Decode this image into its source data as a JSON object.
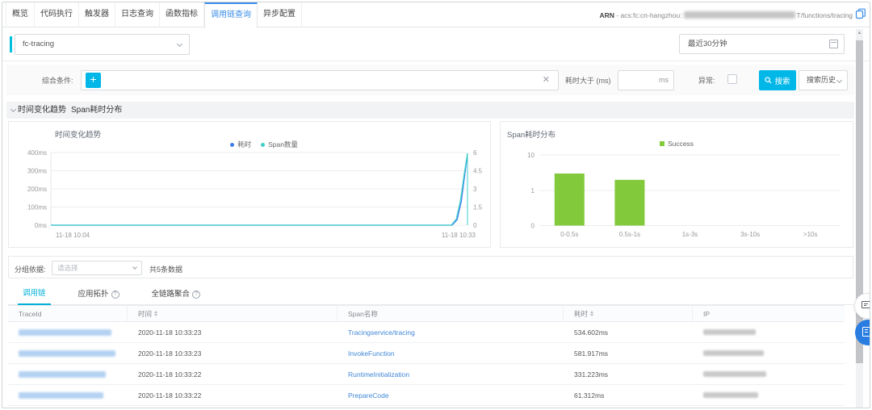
{
  "tabs": {
    "active_index": 5,
    "items": [
      "概览",
      "代码执行",
      "触发器",
      "日志查询",
      "函数指标",
      "调用链查询",
      "异步配置"
    ]
  },
  "arn": {
    "label": "ARN",
    "prefix": " - acs:fc:cn-hangzhou:",
    "redacted": true,
    "suffix": "T/functions/tracing"
  },
  "function_select": {
    "value": "fc-tracing"
  },
  "time_range": {
    "value": "最近30分钟"
  },
  "filter": {
    "condition_label": "综合条件:",
    "duration_label": "耗时大于 (ms)",
    "ms_suffix": "ms",
    "error_label": "异常:",
    "search_label": "搜索",
    "history_label": "搜索历史"
  },
  "section": {
    "title1": "时间变化趋势",
    "title2": "Span耗时分布"
  },
  "chart_data": [
    {
      "type": "line",
      "title": "时间变化趋势",
      "legend": [
        {
          "name": "耗时",
          "color": "#3e7df0"
        },
        {
          "name": "Span数量",
          "color": "#3fcfc9"
        }
      ],
      "series": [
        {
          "name": "耗时",
          "color": "#3e7df0",
          "axis": "left",
          "points": [
            [
              0,
              0
            ],
            [
              0.963,
              0
            ],
            [
              0.975,
              30
            ],
            [
              0.985,
              130
            ],
            [
              0.993,
              270
            ],
            [
              1,
              392
            ]
          ]
        },
        {
          "name": "Span数量",
          "color": "#3fcfc9",
          "axis": "right",
          "points": [
            [
              0,
              0
            ],
            [
              0.961,
              0
            ],
            [
              0.973,
              0.5
            ],
            [
              0.983,
              2.0
            ],
            [
              0.992,
              4.2
            ],
            [
              1,
              5.95
            ]
          ]
        }
      ],
      "left_axis": {
        "labels": [
          "400ms",
          "300ms",
          "200ms",
          "100ms",
          "0ms"
        ],
        "max": 400
      },
      "right_axis": {
        "labels": [
          "6",
          "4.5",
          "3",
          "1.5",
          "0"
        ],
        "max": 6
      },
      "x_labels": [
        "11-18 10:04",
        "11-18 10:33"
      ],
      "grid": true
    },
    {
      "type": "bar",
      "title": "Span耗时分布",
      "legend": [
        {
          "name": "Success",
          "color": "#82c93c"
        }
      ],
      "categories": [
        "0-0.5s",
        "0.5s-1s",
        "1s-3s",
        "3s-10s",
        ">10s"
      ],
      "values": [
        3,
        2,
        0,
        0,
        0
      ],
      "y_ticks": [
        "10",
        "1",
        "0"
      ],
      "scale": "log",
      "color": "#82c93c",
      "grid": true
    }
  ],
  "group_row": {
    "label": "分组依据:",
    "placeholder": "请选择",
    "count": "共5条数据"
  },
  "subtabs": {
    "active_index": 0,
    "items": [
      {
        "label": "调用链",
        "help": false
      },
      {
        "label": "应用拓扑",
        "help": true
      },
      {
        "label": "全链路聚合",
        "help": true
      }
    ]
  },
  "table": {
    "headers": [
      {
        "label": "TraceId",
        "sortable": false
      },
      {
        "label": "时间",
        "sortable": true
      },
      {
        "label": "Span名称",
        "sortable": false
      },
      {
        "label": "耗时",
        "sortable": true
      },
      {
        "label": "IP",
        "sortable": false
      }
    ],
    "rows": [
      {
        "trace_redacted": true,
        "time": "2020-11-18 10:33:23",
        "span": "Tracingservice/tracing",
        "duration": "534.602ms",
        "ip_redacted": true
      },
      {
        "trace_redacted": true,
        "time": "2020-11-18 10:33:23",
        "span": "InvokeFunction",
        "duration": "581.917ms",
        "ip_redacted": true
      },
      {
        "trace_redacted": true,
        "time": "2020-11-18 10:33:22",
        "span": "RuntimeInitialization",
        "duration": "331.223ms",
        "ip_redacted": true
      },
      {
        "trace_redacted": true,
        "time": "2020-11-18 10:33:22",
        "span": "PrepareCode",
        "duration": "61.312ms",
        "ip_redacted": true
      }
    ]
  }
}
